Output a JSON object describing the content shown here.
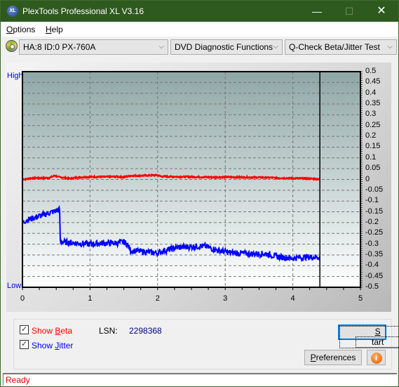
{
  "window": {
    "title": "PlexTools Professional XL V3.16",
    "app_icon": "XL",
    "controls": {
      "minimize": "—",
      "maximize": "☐",
      "close": "✕"
    }
  },
  "menu": {
    "items": [
      {
        "label": "Options",
        "mnemonic": "O",
        "rest": "ptions"
      },
      {
        "label": "Help",
        "mnemonic": "H",
        "rest": "elp"
      }
    ]
  },
  "toolbar": {
    "drive": "HA:8 ID:0  PX-760A",
    "function": "DVD Diagnostic Functions",
    "test": "Q-Check Beta/Jitter Test",
    "arrow": "⌵"
  },
  "chart_labels": {
    "high": "High",
    "low": "Low"
  },
  "chart_data": {
    "type": "line",
    "title": "",
    "xlabel": "",
    "ylabel": "",
    "xlim": [
      0,
      5
    ],
    "ylim": [
      -0.5,
      0.5
    ],
    "x_ticks": [
      "0",
      "1",
      "2",
      "3",
      "4",
      "5"
    ],
    "y_ticks": [
      "0.5",
      "0.45",
      "0.4",
      "0.35",
      "0.3",
      "0.25",
      "0.2",
      "0.15",
      "0.1",
      "0.05",
      "0",
      "-0.05",
      "-0.1",
      "-0.15",
      "-0.2",
      "-0.25",
      "-0.3",
      "-0.35",
      "-0.4",
      "-0.45",
      "-0.5"
    ],
    "grid": true,
    "end_marker_x": 4.4,
    "series": [
      {
        "name": "Beta",
        "color": "#ff0000",
        "x": [
          0,
          0.05,
          0.1,
          0.2,
          0.3,
          0.4,
          0.48,
          0.52,
          0.6,
          0.7,
          0.8,
          1.0,
          1.2,
          1.4,
          1.5,
          1.6,
          1.8,
          2.0,
          2.05,
          2.2,
          2.5,
          2.8,
          3.0,
          3.3,
          3.6,
          3.9,
          4.1,
          4.3,
          4.4
        ],
        "y": [
          0.002,
          0.001,
          0.005,
          0.007,
          0.006,
          0.008,
          0.018,
          0.012,
          0.009,
          0.004,
          0.009,
          0.012,
          0.012,
          0.013,
          0.011,
          0.017,
          0.018,
          0.02,
          0.014,
          0.013,
          0.012,
          0.01,
          0.011,
          0.01,
          0.009,
          0.006,
          0.005,
          0.003,
          0.001
        ]
      },
      {
        "name": "Jitter",
        "color": "#0000ff",
        "x": [
          0,
          0.05,
          0.1,
          0.2,
          0.3,
          0.4,
          0.5,
          0.55,
          0.56,
          0.6,
          0.8,
          1.0,
          1.2,
          1.4,
          1.5,
          1.55,
          1.6,
          1.8,
          1.95,
          2.0,
          2.1,
          2.3,
          2.6,
          2.7,
          2.9,
          3.1,
          3.4,
          3.6,
          3.8,
          4.0,
          4.2,
          4.4
        ],
        "y": [
          -0.2,
          -0.19,
          -0.185,
          -0.175,
          -0.165,
          -0.155,
          -0.145,
          -0.14,
          -0.29,
          -0.29,
          -0.295,
          -0.3,
          -0.295,
          -0.295,
          -0.29,
          -0.3,
          -0.33,
          -0.335,
          -0.34,
          -0.34,
          -0.33,
          -0.315,
          -0.31,
          -0.31,
          -0.33,
          -0.34,
          -0.345,
          -0.345,
          -0.36,
          -0.365,
          -0.36,
          -0.36
        ]
      }
    ]
  },
  "controls": {
    "show_beta": {
      "label_pre": "Show ",
      "mnemonic": "B",
      "label_post": "eta",
      "checked": true,
      "color": "#ff0000"
    },
    "show_jitter": {
      "label_pre": "Show ",
      "mnemonic": "J",
      "label_post": "itter",
      "checked": true,
      "color": "#0000ff"
    },
    "lsn_label": "LSN:",
    "lsn_value": "2298368",
    "start": {
      "mnemonic": "S",
      "rest": "tart"
    },
    "preferences": {
      "mnemonic": "P",
      "rest": "references"
    },
    "info": "i"
  },
  "status": {
    "text": "Ready"
  }
}
